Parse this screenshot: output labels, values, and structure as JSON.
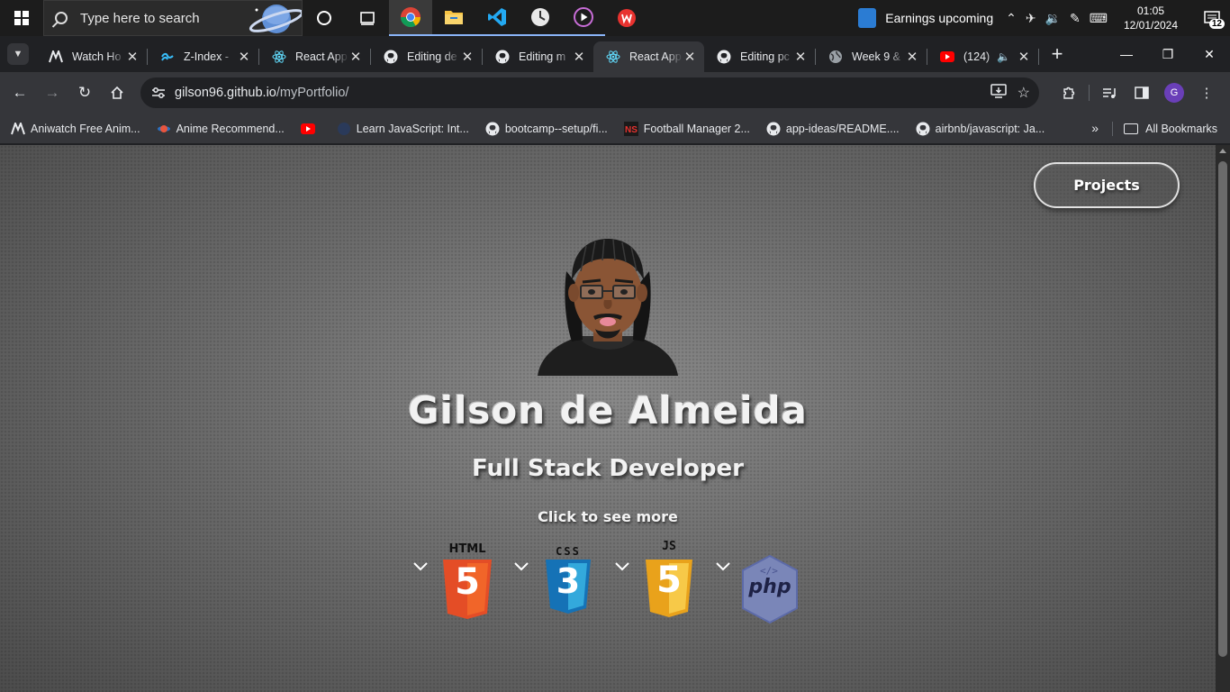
{
  "taskbar": {
    "search_placeholder": "Type here to search",
    "earnings_text": "Earnings upcoming",
    "time": "01:05",
    "date": "12/01/2024",
    "notification_count": "12"
  },
  "tabs": [
    {
      "title": "Watch Ho",
      "icon": "aniwatch-icon"
    },
    {
      "title": "Z-Index -",
      "icon": "tailwind-icon"
    },
    {
      "title": "React App",
      "icon": "react-icon"
    },
    {
      "title": "Editing de",
      "icon": "github-icon"
    },
    {
      "title": "Editing m",
      "icon": "github-icon"
    },
    {
      "title": "React App",
      "icon": "react-icon",
      "active": true
    },
    {
      "title": "Editing pc",
      "icon": "github-icon"
    },
    {
      "title": "Week 9 &",
      "icon": "globe-icon"
    },
    {
      "title": "(124)",
      "icon": "youtube-icon",
      "audio": true
    }
  ],
  "address": {
    "host": "gilson96.github.io",
    "path": "/myPortfolio/"
  },
  "bookmarks": [
    {
      "label": "Aniwatch Free Anim...",
      "icon": "aniwatch-icon"
    },
    {
      "label": "Anime Recommend...",
      "icon": "planet-icon"
    },
    {
      "label": "",
      "icon": "youtube-icon"
    },
    {
      "label": "Learn JavaScript: Int...",
      "icon": "code-icon"
    },
    {
      "label": "bootcamp--setup/fi...",
      "icon": "github-icon"
    },
    {
      "label": "Football Manager 2...",
      "icon": "fm-icon"
    },
    {
      "label": "app-ideas/README....",
      "icon": "github-icon"
    },
    {
      "label": "airbnb/javascript: Ja...",
      "icon": "github-icon"
    }
  ],
  "bookmarks_all": "All Bookmarks",
  "profile_initial": "G",
  "page": {
    "projects_button": "Projects",
    "name": "Gilson de Almeida",
    "role": "Full Stack Developer",
    "hint": "Click to see more",
    "tech": [
      {
        "label": "HTML",
        "number": "5",
        "color": "#e44d26"
      },
      {
        "label": "CSS",
        "number": "3",
        "color": "#1572b6"
      },
      {
        "label": "JS",
        "number": "5",
        "color": "#f0b429"
      },
      {
        "label": "php",
        "color": "#7a86b8"
      }
    ]
  }
}
